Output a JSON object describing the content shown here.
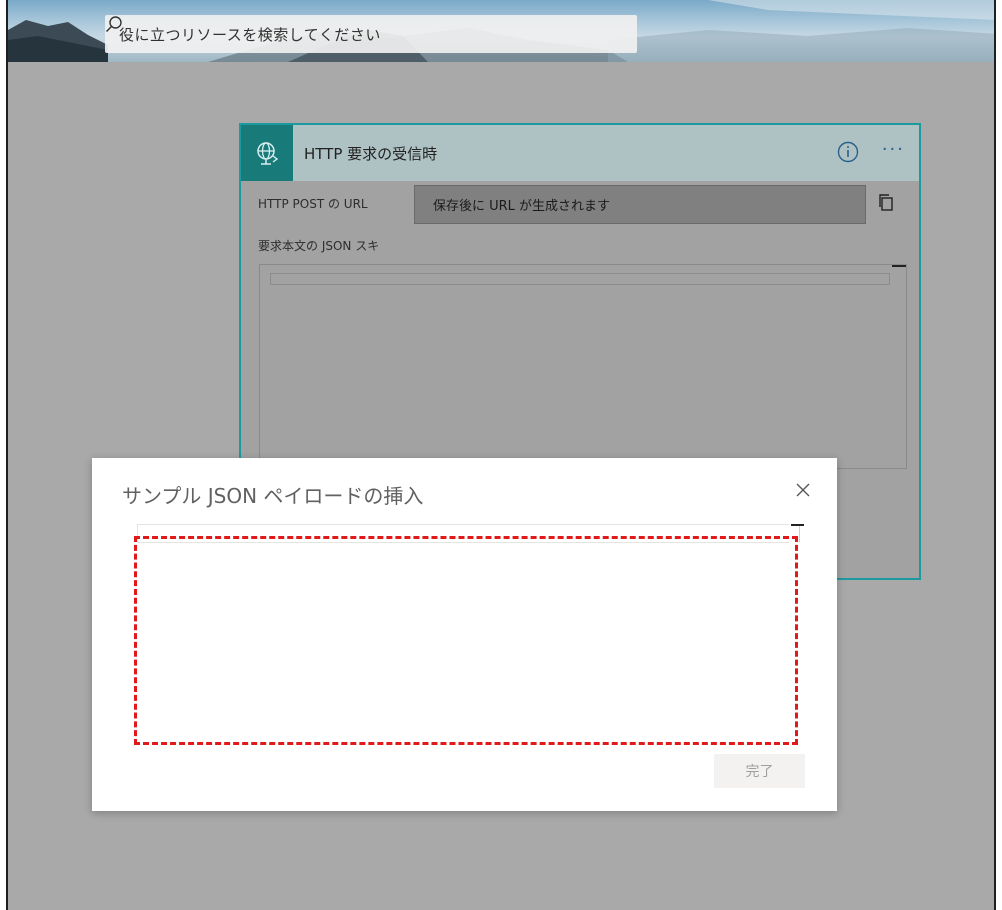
{
  "search": {
    "placeholder": "役に立つリソースを検索してください",
    "icon": "search-icon"
  },
  "card": {
    "title": "HTTP 要求の受信時",
    "trigger_icon": "globe-request-icon",
    "info_icon": "info-icon",
    "more_icon": "more-options-icon",
    "more_label": "···",
    "url_field": {
      "label": "HTTP POST の URL",
      "value": "保存後に URL が生成されます",
      "copy_icon": "copy-icon"
    },
    "schema_field": {
      "label": "要求本文の JSON スキーマ",
      "label_visible": "要求本文の JSON スキ"
    },
    "accent_color": "#1d9aa0",
    "header_icon_color": "#197a7a"
  },
  "dialog": {
    "title": "サンプル JSON ペイロードの挿入",
    "close_icon": "close-icon",
    "editor_value": "",
    "done_label": "完了",
    "highlight_color": "#e0191b"
  }
}
